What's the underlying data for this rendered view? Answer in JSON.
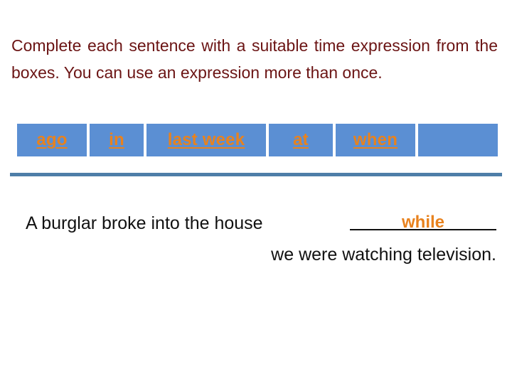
{
  "slide": {
    "instructions": "Complete each sentence with a suitable time expression from the boxes. You can use an expression more than once.",
    "instruction_color": "#6b1414",
    "background_color": "#ffffff"
  },
  "word_bank": {
    "cell_background": "#5b8fd3",
    "word_color": "#e8821e",
    "cells": [
      {
        "label": "ago",
        "empty": false
      },
      {
        "label": "in",
        "empty": false
      },
      {
        "label": "last week",
        "empty": false
      },
      {
        "label": "at",
        "empty": false
      },
      {
        "label": "when",
        "empty": false
      },
      {
        "label": "",
        "empty": true
      }
    ]
  },
  "divider": {
    "color": "#4e7ea8"
  },
  "exercise": {
    "lead_text": "A burglar broke into the house",
    "answer": "while",
    "answer_color": "#e8821e",
    "tail_text": "we were watching television."
  }
}
